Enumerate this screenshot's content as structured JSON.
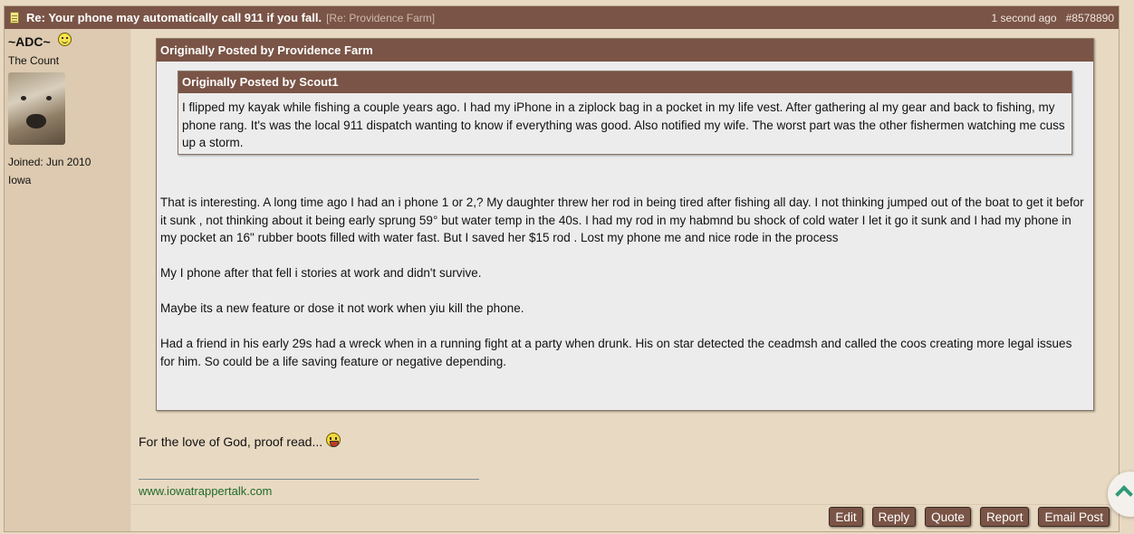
{
  "post": {
    "subject": "Re: Your phone may automatically call 911 if you fall.",
    "forum_tag": "[Re: Providence Farm]",
    "time": "1 second ago",
    "post_number": "#8578890"
  },
  "author": {
    "username": "~ADC~",
    "title": "The Count",
    "joined": "Joined: Jun 2010",
    "location": "Iowa"
  },
  "outer_quote": {
    "header": "Originally Posted by Providence Farm",
    "paragraphs": [
      "That is interesting. A long time ago I had an i phone 1 or 2,? My daughter threw her rod in being tired after fishing all day. I not thinking jumped out of the boat to get it befor it sunk , not thinking about it being early sprung 59° but water temp in the 40s. I had my rod in my habmnd bu shock of cold water I let it go it sunk and I had my phone in my pocket an 16\" rubber boots filled with water fast. But I saved her $15 rod . Lost my phone me and nice rode in the process",
      "My I phone after that fell i stories at work and didn't survive.",
      "Maybe its a new feature or dose it not work when yiu kill the phone.",
      "Had a friend in his early 29s had a wreck when in a running fight at a party when drunk. His on star detected the ceadmsh and called the coos creating more legal issues for him. So could be a life saving feature or negative depending."
    ]
  },
  "inner_quote": {
    "header": "Originally Posted by Scout1",
    "body": "I flipped my kayak while fishing a couple years ago. I had my iPhone in a ziplock bag in a pocket in my life vest. After gathering al my gear and back to fishing, my phone rang. It's was the local 911 dispatch wanting to know if everything was good. Also notified my wife. The worst part was the other fishermen watching me cuss up a storm."
  },
  "reply_text": "For the love of God, proof read...",
  "signature_link": "www.iowatrappertalk.com",
  "actions": {
    "edit": "Edit",
    "reply": "Reply",
    "quote": "Quote",
    "report": "Report",
    "email_post": "Email Post"
  },
  "colors": {
    "header_bg": "#7a5446",
    "sidebar_bg": "#ddcab0",
    "page_bg": "#e8d9c2",
    "link_green": "#1f6b2a",
    "scroll_chevron": "#2e9a77"
  },
  "icons": {
    "post_icon": "note-icon",
    "status_icon": "smile-icon",
    "reply_emoji": "laugh-icon",
    "scroll_button": "chevron-up-icon"
  }
}
